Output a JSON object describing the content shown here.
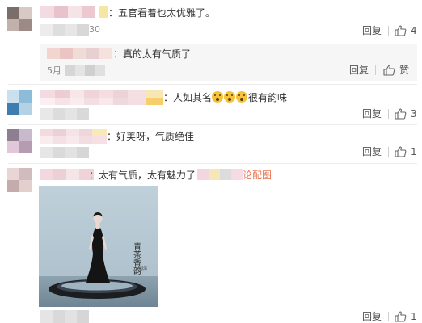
{
  "comments": [
    {
      "text": "五官看着也太优雅了。",
      "time_partial": "30",
      "reply_label": "回复",
      "like_count": "4",
      "sub_reply": {
        "text": "真的太有气质了",
        "time_partial": "5月",
        "reply_label": "回复",
        "like_label": "赞"
      }
    },
    {
      "text_before": "人如其名",
      "text_after": "很有韵味",
      "emoji_count": 3,
      "reply_label": "回复",
      "like_count": "3"
    },
    {
      "text": "好美呀，气质绝佳",
      "reply_label": "回复",
      "like_count": "1"
    },
    {
      "text": "太有气质，太有魅力了",
      "link_text": "论配图",
      "reply_label": "回复",
      "like_count": "1",
      "image": {
        "caption_vertical": "青茶香韵",
        "caption_small": "周深"
      }
    }
  ],
  "colors": {
    "link": "#eb7350",
    "text": "#333333",
    "meta": "#888888",
    "reply_bg": "#f6f6f6"
  },
  "icons": {
    "like": "thumbs-up-icon",
    "emoji": "surprised-face-emoji"
  }
}
